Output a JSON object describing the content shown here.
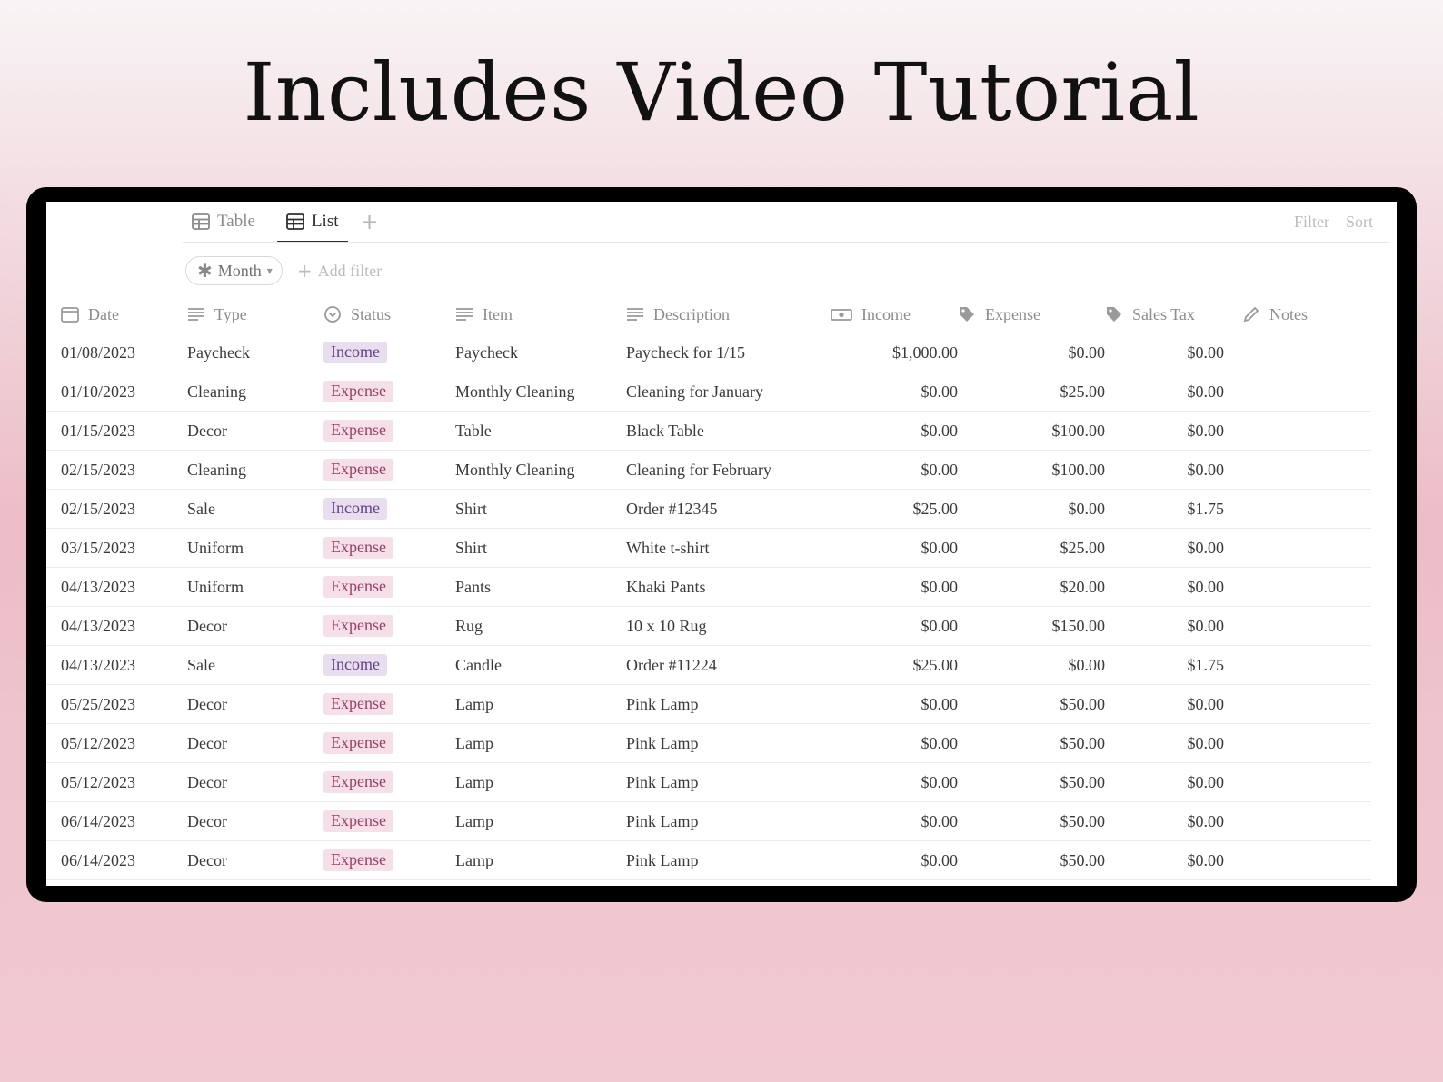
{
  "headline": "Includes Video Tutorial",
  "views": [
    {
      "label": "Table",
      "icon": "table-icon",
      "active": false
    },
    {
      "label": "List",
      "icon": "table-icon",
      "active": true
    }
  ],
  "add_view_label": "+",
  "actions": {
    "filter_label": "Filter",
    "sort_label": "Sort"
  },
  "filter_chip": {
    "label": "Month",
    "icon": "sparkle-icon"
  },
  "add_filter_label": "Add filter",
  "columns": [
    {
      "label": "Date",
      "icon": "calendar-icon"
    },
    {
      "label": "Type",
      "icon": "text-lines-icon"
    },
    {
      "label": "Status",
      "icon": "status-icon"
    },
    {
      "label": "Item",
      "icon": "text-lines-icon"
    },
    {
      "label": "Description",
      "icon": "text-lines-icon"
    },
    {
      "label": "Income",
      "icon": "money-icon"
    },
    {
      "label": "Expense",
      "icon": "tag-icon"
    },
    {
      "label": "Sales Tax",
      "icon": "tag-icon"
    },
    {
      "label": "Notes",
      "icon": "pencil-icon"
    }
  ],
  "status_colors": {
    "Income": "#e8deee",
    "Expense": "#f5e0e9"
  },
  "rows": [
    {
      "date": "01/08/2023",
      "type": "Paycheck",
      "status": "Income",
      "item": "Paycheck",
      "description": "Paycheck for 1/15",
      "income": "$1,000.00",
      "expense": "$0.00",
      "tax": "$0.00",
      "notes": ""
    },
    {
      "date": "01/10/2023",
      "type": "Cleaning",
      "status": "Expense",
      "item": "Monthly Cleaning",
      "description": "Cleaning for January",
      "income": "$0.00",
      "expense": "$25.00",
      "tax": "$0.00",
      "notes": ""
    },
    {
      "date": "01/15/2023",
      "type": "Decor",
      "status": "Expense",
      "item": "Table",
      "description": "Black Table",
      "income": "$0.00",
      "expense": "$100.00",
      "tax": "$0.00",
      "notes": ""
    },
    {
      "date": "02/15/2023",
      "type": "Cleaning",
      "status": "Expense",
      "item": "Monthly Cleaning",
      "description": "Cleaning for February",
      "income": "$0.00",
      "expense": "$100.00",
      "tax": "$0.00",
      "notes": ""
    },
    {
      "date": "02/15/2023",
      "type": "Sale",
      "status": "Income",
      "item": "Shirt",
      "description": "Order #12345",
      "income": "$25.00",
      "expense": "$0.00",
      "tax": "$1.75",
      "notes": ""
    },
    {
      "date": "03/15/2023",
      "type": "Uniform",
      "status": "Expense",
      "item": "Shirt",
      "description": "White t-shirt",
      "income": "$0.00",
      "expense": "$25.00",
      "tax": "$0.00",
      "notes": ""
    },
    {
      "date": "04/13/2023",
      "type": "Uniform",
      "status": "Expense",
      "item": "Pants",
      "description": "Khaki Pants",
      "income": "$0.00",
      "expense": "$20.00",
      "tax": "$0.00",
      "notes": ""
    },
    {
      "date": "04/13/2023",
      "type": "Decor",
      "status": "Expense",
      "item": "Rug",
      "description": "10 x 10 Rug",
      "income": "$0.00",
      "expense": "$150.00",
      "tax": "$0.00",
      "notes": ""
    },
    {
      "date": "04/13/2023",
      "type": "Sale",
      "status": "Income",
      "item": "Candle",
      "description": "Order #11224",
      "income": "$25.00",
      "expense": "$0.00",
      "tax": "$1.75",
      "notes": ""
    },
    {
      "date": "05/25/2023",
      "type": "Decor",
      "status": "Expense",
      "item": "Lamp",
      "description": "Pink Lamp",
      "income": "$0.00",
      "expense": "$50.00",
      "tax": "$0.00",
      "notes": ""
    },
    {
      "date": "05/12/2023",
      "type": "Decor",
      "status": "Expense",
      "item": "Lamp",
      "description": "Pink Lamp",
      "income": "$0.00",
      "expense": "$50.00",
      "tax": "$0.00",
      "notes": ""
    },
    {
      "date": "05/12/2023",
      "type": "Decor",
      "status": "Expense",
      "item": "Lamp",
      "description": "Pink Lamp",
      "income": "$0.00",
      "expense": "$50.00",
      "tax": "$0.00",
      "notes": ""
    },
    {
      "date": "06/14/2023",
      "type": "Decor",
      "status": "Expense",
      "item": "Lamp",
      "description": "Pink Lamp",
      "income": "$0.00",
      "expense": "$50.00",
      "tax": "$0.00",
      "notes": ""
    },
    {
      "date": "06/14/2023",
      "type": "Decor",
      "status": "Expense",
      "item": "Lamp",
      "description": "Pink Lamp",
      "income": "$0.00",
      "expense": "$50.00",
      "tax": "$0.00",
      "notes": ""
    }
  ]
}
